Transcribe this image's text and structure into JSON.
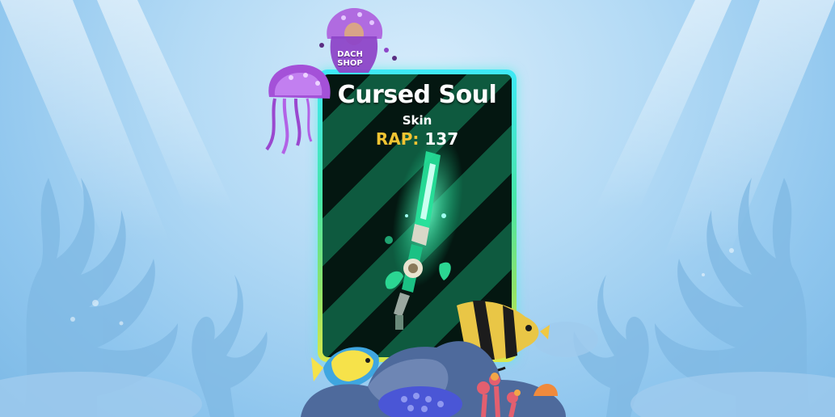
{
  "item": {
    "name": "Cursed Soul",
    "type": "Skin",
    "rap_label": "RAP:",
    "rap_value": "137"
  },
  "shop": {
    "line1": "DACH",
    "line2": "SHOP"
  },
  "colors": {
    "card_border_top": "#3ee8f6",
    "card_border_bottom": "#d9e94a",
    "card_stripe_dark": "#041711",
    "card_stripe_light": "#0e5a3f",
    "rap_label": "#f3c432",
    "ocean": "#b3daf5"
  },
  "icons": [
    "jellyfish-icon",
    "shop-avatar-icon",
    "cursed-sword-icon",
    "angelfish-icon",
    "tang-fish-icon",
    "coral-rock-icon"
  ]
}
